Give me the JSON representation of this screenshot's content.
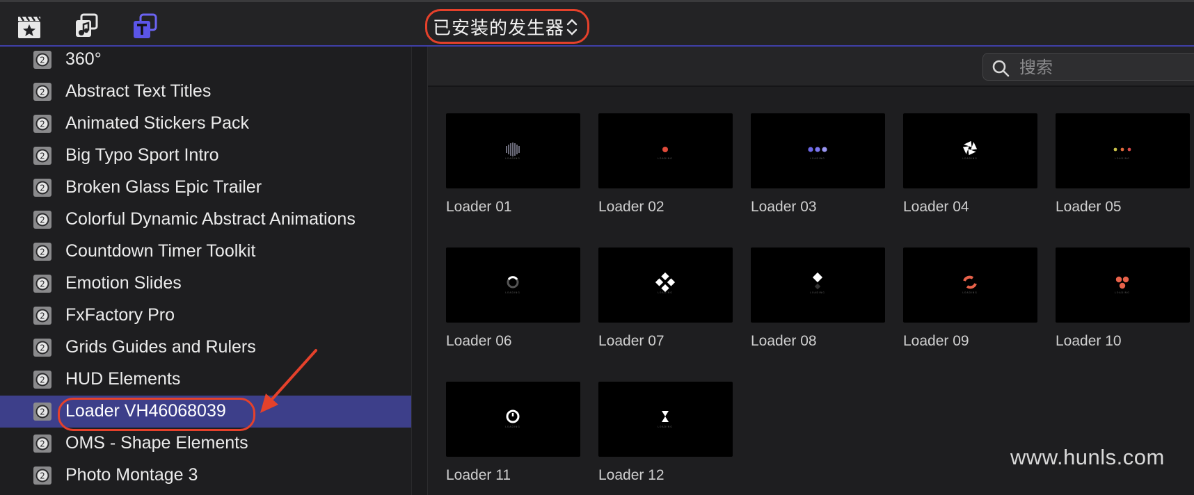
{
  "toolbar": {
    "icons": [
      "clapper-star-icon",
      "photos-music-icon",
      "titles-generators-icon"
    ],
    "library_popup_label": "已安装的发生器"
  },
  "sidebar": {
    "items": [
      {
        "label": "360°"
      },
      {
        "label": "Abstract Text Titles"
      },
      {
        "label": "Animated Stickers Pack"
      },
      {
        "label": "Big Typo Sport Intro"
      },
      {
        "label": "Broken Glass Epic Trailer"
      },
      {
        "label": "Colorful Dynamic Abstract Animations"
      },
      {
        "label": "Countdown Timer Toolkit"
      },
      {
        "label": "Emotion Slides"
      },
      {
        "label": "FxFactory Pro"
      },
      {
        "label": "Grids Guides and Rulers"
      },
      {
        "label": "HUD Elements"
      },
      {
        "label": "Loader VH46068039",
        "selected": true
      },
      {
        "label": "OMS - Shape Elements"
      },
      {
        "label": "Photo Montage 3"
      }
    ],
    "badge_glyph": "2"
  },
  "search": {
    "placeholder": "搜索",
    "value": ""
  },
  "browser": {
    "tiles": [
      {
        "name": "Loader 01",
        "preview": "bars"
      },
      {
        "name": "Loader 02",
        "preview": "red-dot"
      },
      {
        "name": "Loader 03",
        "preview": "three-purple-dots"
      },
      {
        "name": "Loader 04",
        "preview": "white-pinwheel"
      },
      {
        "name": "Loader 05",
        "preview": "three-color-dots"
      },
      {
        "name": "Loader 06",
        "preview": "ring"
      },
      {
        "name": "Loader 07",
        "preview": "white-squares"
      },
      {
        "name": "Loader 08",
        "preview": "white-diamond"
      },
      {
        "name": "Loader 09",
        "preview": "red-arcs"
      },
      {
        "name": "Loader 10",
        "preview": "red-triangle-dots"
      },
      {
        "name": "Loader 11",
        "preview": "white-clock"
      },
      {
        "name": "Loader 12",
        "preview": "white-hourglass"
      }
    ],
    "preview_caption": "LOADING"
  },
  "colors": {
    "accent": "#3f3fa8",
    "selection": "#3d3f8a",
    "annotation_red": "#e5412b"
  },
  "watermark": "www.hunls.com"
}
